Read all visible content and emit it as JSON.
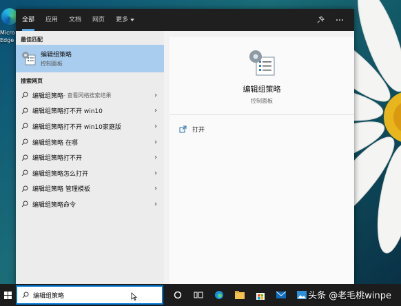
{
  "desktop": {
    "edge_label": "Micro\nEdge"
  },
  "tabs": [
    {
      "label": "全部"
    },
    {
      "label": "应用"
    },
    {
      "label": "文档"
    },
    {
      "label": "网页"
    },
    {
      "label": "更多"
    }
  ],
  "best_match": {
    "heading": "最佳匹配",
    "title": "编辑组策略",
    "subtitle": "控制面板"
  },
  "web_search": {
    "heading": "搜索网页",
    "items": [
      {
        "text": "编辑组策略",
        "sub": " - 查看网络搜索结果"
      },
      {
        "text": "编辑组策略打不开 win10"
      },
      {
        "text": "编辑组策略打不开 win10家庭版"
      },
      {
        "text": "编辑组策略 在哪"
      },
      {
        "text": "编辑组策略打不开"
      },
      {
        "text": "编辑组策略怎么打开"
      },
      {
        "text": "编辑组策略 管理模板"
      },
      {
        "text": "编辑组策略命令"
      }
    ]
  },
  "detail": {
    "title": "编辑组策略",
    "category": "控制面板",
    "actions": [
      {
        "label": "打开",
        "icon": "open-icon"
      }
    ]
  },
  "taskbar": {
    "search_value": "编辑组策略",
    "watermark": "头条 @老毛桃winpe"
  },
  "colors": {
    "accent": "#0078d7",
    "selected": "#a9cdee",
    "topbar": "#1f1f1f"
  }
}
